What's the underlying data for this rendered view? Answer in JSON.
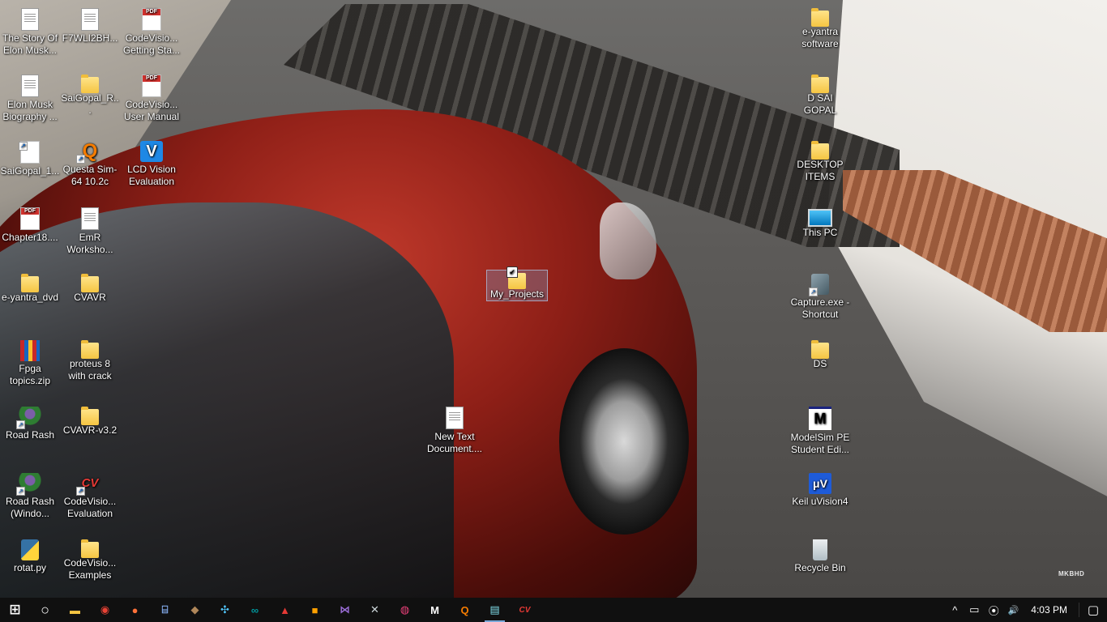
{
  "desktop": {
    "watermark": "MKBHD",
    "left_icons": [
      {
        "label": "The Story Of Elon Musk...",
        "icon": "document-icon"
      },
      {
        "label": "F7WLI2BH...",
        "icon": "document-icon"
      },
      {
        "label": "CodeVisio... Getting Sta...",
        "icon": "pdf-icon"
      },
      {
        "label": "Elon Musk Biography ...",
        "icon": "document-icon"
      },
      {
        "label": "SaiGopal_R...",
        "icon": "folder-icon"
      },
      {
        "label": "CodeVisio... User Manual",
        "icon": "pdf-icon"
      },
      {
        "label": "SaiGopal_1...",
        "icon": "pdf-icon"
      },
      {
        "label": "Questa Sim-64 10.2c",
        "icon": "questa-icon"
      },
      {
        "label": "LCD Vision Evaluation",
        "icon": "lcd-vision-icon"
      },
      {
        "label": "Chapter18....",
        "icon": "pdf-icon"
      },
      {
        "label": "EmR Worksho...",
        "icon": "document-icon"
      },
      {
        "label": "e-yantra_dvd",
        "icon": "folder-icon"
      },
      {
        "label": "CVAVR",
        "icon": "folder-icon"
      },
      {
        "label": "Fpga topics.zip",
        "icon": "zip-icon"
      },
      {
        "label": "proteus 8 with crack",
        "icon": "folder-icon"
      },
      {
        "label": "Road Rash",
        "icon": "game-icon"
      },
      {
        "label": "CVAVR-v3.2",
        "icon": "folder-icon"
      },
      {
        "label": "Road Rash (Windo...",
        "icon": "game-icon"
      },
      {
        "label": "CodeVisio... Evaluation",
        "icon": "cvavr-icon"
      },
      {
        "label": "rotat.py",
        "icon": "python-file-icon"
      },
      {
        "label": "CodeVisio... Examples",
        "icon": "folder-icon"
      }
    ],
    "center_icons": [
      {
        "label": "My_Projects",
        "icon": "folder-icon",
        "selected": true
      },
      {
        "label": "New Text Document....",
        "icon": "text-document-icon"
      }
    ],
    "right_icons": [
      {
        "label": "e-yantra software",
        "icon": "folder-icon"
      },
      {
        "label": "D SAI GOPAL",
        "icon": "user-folder-icon"
      },
      {
        "label": "DESKTOP ITEMS",
        "icon": "folder-icon"
      },
      {
        "label": "This PC",
        "icon": "this-pc-icon"
      },
      {
        "label": "Capture.exe - Shortcut",
        "icon": "capture-icon"
      },
      {
        "label": "DS",
        "icon": "folder-icon"
      },
      {
        "label": "ModelSim PE Student Edi...",
        "icon": "modelsim-icon"
      },
      {
        "label": "Keil uVision4",
        "icon": "keil-icon"
      },
      {
        "label": "Recycle Bin",
        "icon": "recycle-bin-icon"
      }
    ]
  },
  "taskbar": {
    "buttons": [
      {
        "name": "start-button",
        "icon": "windows-logo-icon",
        "glyph": "⊞"
      },
      {
        "name": "cortana-button",
        "icon": "cortana-circle-icon",
        "glyph": "○"
      },
      {
        "name": "file-explorer-button",
        "icon": "file-explorer-icon",
        "glyph": "▬"
      },
      {
        "name": "chrome-button",
        "icon": "chrome-icon",
        "glyph": "◉"
      },
      {
        "name": "firefox-button",
        "icon": "firefox-icon",
        "glyph": "●"
      },
      {
        "name": "app-button-1",
        "icon": "network-app-icon",
        "glyph": "⌸"
      },
      {
        "name": "app-button-2",
        "icon": "package-icon",
        "glyph": "◆"
      },
      {
        "name": "app-button-3",
        "icon": "molecule-icon",
        "glyph": "✣"
      },
      {
        "name": "arduino-button",
        "icon": "arduino-icon",
        "glyph": "∞"
      },
      {
        "name": "app-button-4",
        "icon": "red-app-icon",
        "glyph": "▲"
      },
      {
        "name": "app-button-5",
        "icon": "orange-square-icon",
        "glyph": "■"
      },
      {
        "name": "visual-studio-button",
        "icon": "visual-studio-icon",
        "glyph": "⋈"
      },
      {
        "name": "app-button-6",
        "icon": "butterfly-icon",
        "glyph": "✕"
      },
      {
        "name": "app-button-7",
        "icon": "swirl-icon",
        "glyph": "◍"
      },
      {
        "name": "modelsim-button",
        "icon": "modelsim-icon",
        "glyph": "M"
      },
      {
        "name": "questa-button",
        "icon": "questa-icon",
        "glyph": "Q"
      },
      {
        "name": "notepad-button",
        "icon": "notepad-icon",
        "glyph": "▤"
      },
      {
        "name": "cvavr-button",
        "icon": "cvavr-icon",
        "glyph": "CV"
      }
    ],
    "tray": {
      "chevron": "^",
      "battery": "▭",
      "network": "⦿",
      "volume": "🔊",
      "clock": "4:03 PM",
      "notifications": "▢"
    }
  },
  "colors": {
    "taskbar_bg": "#101010",
    "open_indicator": "#7aa7d8",
    "selection": "#7896be"
  }
}
